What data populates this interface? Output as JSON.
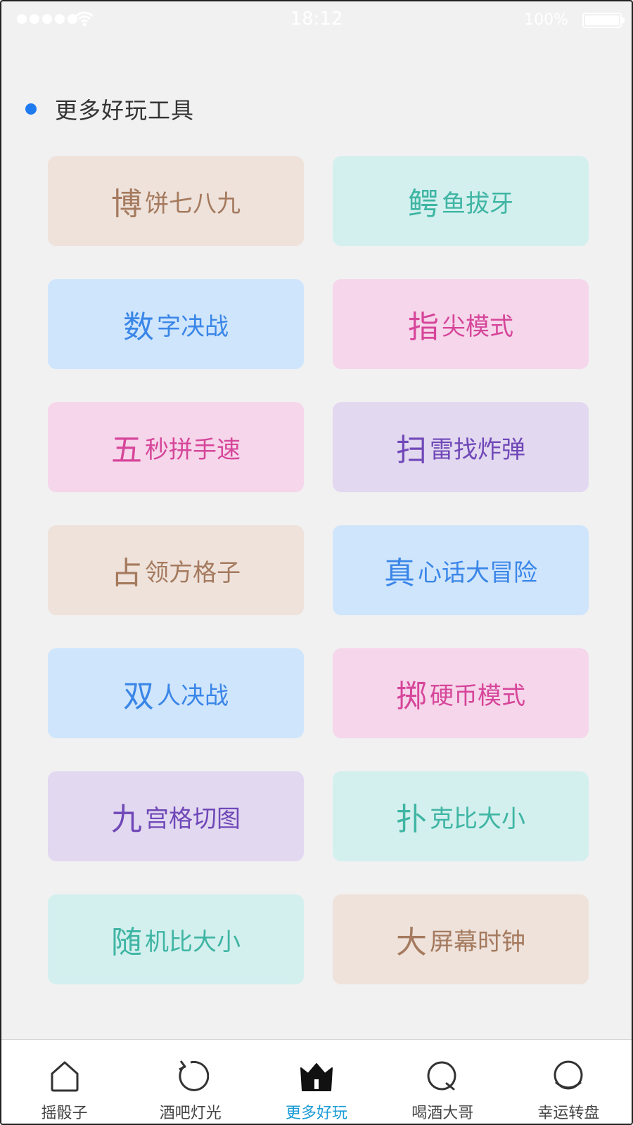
{
  "status_bar": {
    "time": "18:12",
    "battery_text": "100%",
    "battery_level": 1.0
  },
  "section": {
    "title": "更多好玩工具",
    "accent_color": "#1f7af0"
  },
  "tools": [
    {
      "first": "博",
      "rest": "饼七八九",
      "bg": "#eee2db",
      "fg": "#a57a5e"
    },
    {
      "first": "鳄",
      "rest": "鱼拔牙",
      "bg": "#d3f0ef",
      "fg": "#3fb5a3"
    },
    {
      "first": "数",
      "rest": "字决战",
      "bg": "#cfe5fc",
      "fg": "#3a86e8"
    },
    {
      "first": "指",
      "rest": "尖模式",
      "bg": "#f6d6ea",
      "fg": "#d6469a"
    },
    {
      "first": "五",
      "rest": "秒拼手速",
      "bg": "#f6d6ea",
      "fg": "#d6469a"
    },
    {
      "first": "扫",
      "rest": "雷找炸弹",
      "bg": "#e2d8f0",
      "fg": "#7048b8"
    },
    {
      "first": "占",
      "rest": "领方格子",
      "bg": "#eee2db",
      "fg": "#a57a5e"
    },
    {
      "first": "真",
      "rest": "心话大冒险",
      "bg": "#cfe5fc",
      "fg": "#3a86e8"
    },
    {
      "first": "双",
      "rest": "人决战",
      "bg": "#cfe5fc",
      "fg": "#3a86e8"
    },
    {
      "first": "掷",
      "rest": "硬币模式",
      "bg": "#f6d6ea",
      "fg": "#d6469a"
    },
    {
      "first": "九",
      "rest": "宫格切图",
      "bg": "#e2d8f0",
      "fg": "#7048b8"
    },
    {
      "first": "扑",
      "rest": "克比大小",
      "bg": "#d3f0ef",
      "fg": "#3fb5a3"
    },
    {
      "first": "随",
      "rest": "机比大小",
      "bg": "#d3f0ef",
      "fg": "#3fb5a3"
    },
    {
      "first": "大",
      "rest": "屏幕时钟",
      "bg": "#eee2db",
      "fg": "#a57a5e"
    }
  ],
  "tab_bar": {
    "active_color": "#1a9bd6",
    "tabs": [
      {
        "label": "摇骰子",
        "icon": "house-icon",
        "active": false
      },
      {
        "label": "酒吧灯光",
        "icon": "refresh-circle-icon",
        "active": false
      },
      {
        "label": "更多好玩",
        "icon": "crown-icon",
        "active": true
      },
      {
        "label": "喝酒大哥",
        "icon": "search-circle-icon",
        "active": false
      },
      {
        "label": "幸运转盘",
        "icon": "spinner-icon",
        "active": false
      }
    ]
  }
}
